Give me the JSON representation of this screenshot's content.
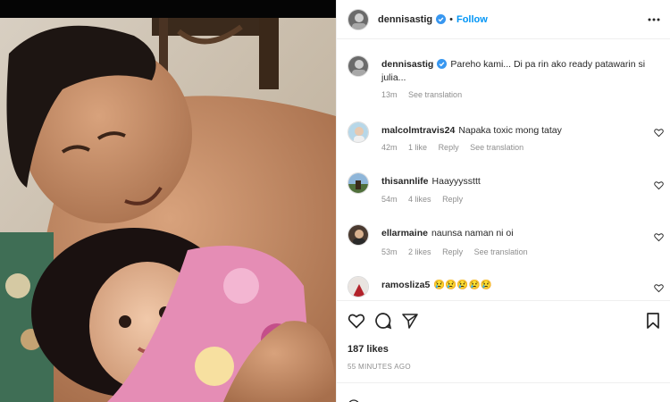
{
  "post": {
    "author": "dennisastig",
    "follow_label": "Follow",
    "separator": "•",
    "caption": "Pareho kami... Di pa rin ako ready patawarin si julia...",
    "caption_time": "13m",
    "see_translation": "See translation",
    "likes": "187 likes",
    "posted_ago": "55 MINUTES AGO",
    "icons": {
      "more": "more-options-icon",
      "like": "heart-icon",
      "comment": "comment-bubble-icon",
      "share": "paper-plane-icon",
      "save": "bookmark-icon",
      "emoji": "emoji-icon",
      "verified": "verified-badge-icon"
    },
    "accent": "#0095f6"
  },
  "comments": [
    {
      "user": "malcolmtravis24",
      "text": "Napaka toxic mong tatay",
      "time": "42m",
      "likes": "1 like",
      "reply": "Reply",
      "translate": "See translation"
    },
    {
      "user": "thisannlife",
      "text": "Haayyyssttt",
      "time": "54m",
      "likes": "4 likes",
      "reply": "Reply",
      "translate": ""
    },
    {
      "user": "ellarmaine",
      "text": "naunsa naman ni oi",
      "time": "53m",
      "likes": "2 likes",
      "reply": "Reply",
      "translate": "See translation"
    },
    {
      "user": "ramosliza5",
      "text": "😢😢😢😢😢",
      "time": "",
      "likes": "",
      "reply": "",
      "translate": ""
    }
  ]
}
